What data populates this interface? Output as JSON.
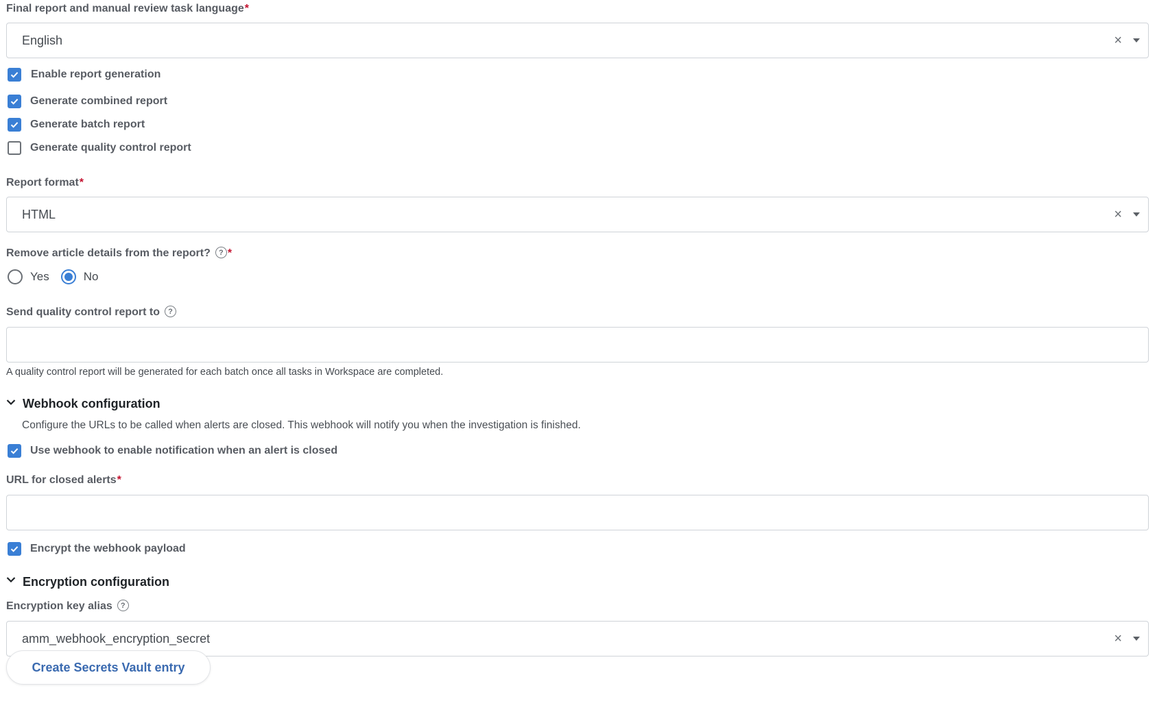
{
  "language": {
    "label": "Final report and manual review task language",
    "required_mark": "*",
    "value": "English",
    "clear_glyph": "×"
  },
  "checkboxes": {
    "enable_report": {
      "label": "Enable report generation",
      "checked": true
    },
    "combined_report": {
      "label": "Generate combined report",
      "checked": true
    },
    "batch_report": {
      "label": "Generate batch report",
      "checked": true
    },
    "qc_report": {
      "label": "Generate quality control report",
      "checked": false
    }
  },
  "report_format": {
    "label": "Report format",
    "required_mark": "*",
    "value": "HTML",
    "clear_glyph": "×"
  },
  "remove_details": {
    "label": "Remove article details from the report?",
    "required_mark": "*",
    "help_glyph": "?",
    "options": [
      "Yes",
      "No"
    ],
    "selected": "No"
  },
  "qc_recipient": {
    "label": "Send quality control report to",
    "help_glyph": "?",
    "value": "",
    "hint": "A quality control report will be generated for each batch once all tasks in Workspace are completed."
  },
  "webhook": {
    "title": "Webhook configuration",
    "description": "Configure the URLs to be called when alerts are closed. This webhook will notify you when the investigation is finished.",
    "use_webhook": {
      "label": "Use webhook to enable notification when an alert is closed",
      "checked": true
    },
    "url_label": "URL for closed alerts",
    "url_required_mark": "*",
    "url_value": "",
    "encrypt": {
      "label": "Encrypt the webhook payload",
      "checked": true
    }
  },
  "encryption": {
    "title": "Encryption configuration",
    "key_alias_label": "Encryption key alias",
    "help_glyph": "?",
    "key_alias_value": "amm_webhook_encryption_secret",
    "clear_glyph": "×",
    "create_button": "Create Secrets Vault entry"
  },
  "colors": {
    "accent": "#3a7fd5",
    "required": "#c4122f",
    "button_text": "#3a6ab0",
    "border": "#cfd3d8"
  },
  "icons": {
    "check": "checkmark-icon",
    "clear": "close-icon",
    "dropdown": "caret-down-icon",
    "help": "help-circle-icon",
    "collapse": "chevron-down-icon"
  }
}
